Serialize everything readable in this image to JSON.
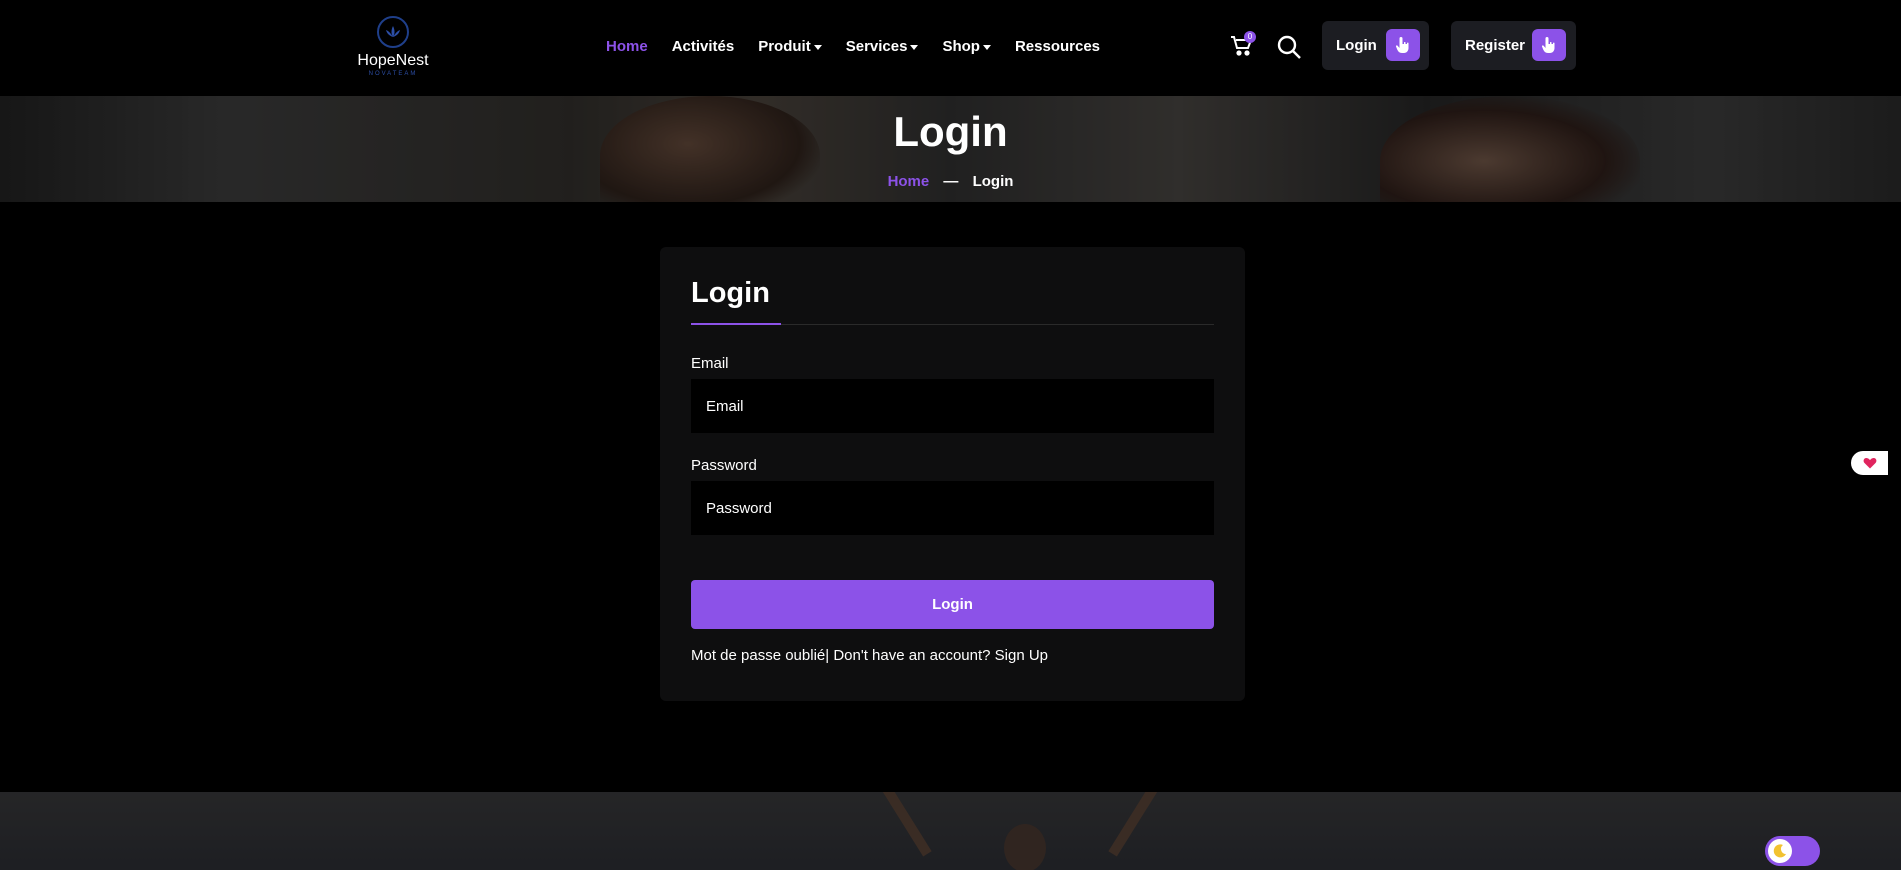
{
  "brand": {
    "name": "HopeNest",
    "tagline": "NOVATEAM"
  },
  "nav": {
    "items": [
      {
        "label": "Home",
        "active": true,
        "dropdown": false
      },
      {
        "label": "Activités",
        "active": false,
        "dropdown": false
      },
      {
        "label": "Produit",
        "active": false,
        "dropdown": true
      },
      {
        "label": "Services",
        "active": false,
        "dropdown": true
      },
      {
        "label": "Shop",
        "active": false,
        "dropdown": true
      },
      {
        "label": "Ressources",
        "active": false,
        "dropdown": false
      }
    ]
  },
  "header": {
    "cart_count": "0",
    "login_label": "Login",
    "register_label": "Register"
  },
  "hero": {
    "title": "Login",
    "breadcrumb": {
      "home": "Home",
      "separator": "—",
      "current": "Login"
    }
  },
  "form": {
    "title": "Login",
    "email_label": "Email",
    "email_placeholder": "Email",
    "password_label": "Password",
    "password_placeholder": "Password",
    "submit_label": "Login",
    "forgot_text": "Mot de passe oublié",
    "divider": "|",
    "signup_prompt": " Don't have an account? Sign Up"
  },
  "colors": {
    "accent": "#8c52e8",
    "background": "#000000",
    "card": "#0e0e0f",
    "button_dark": "#1c1d22"
  },
  "icons": {
    "cart": "cart-icon",
    "search": "search-icon",
    "hand": "pointer-hand-icon",
    "heart": "heart-icon",
    "moon": "moon-icon"
  }
}
